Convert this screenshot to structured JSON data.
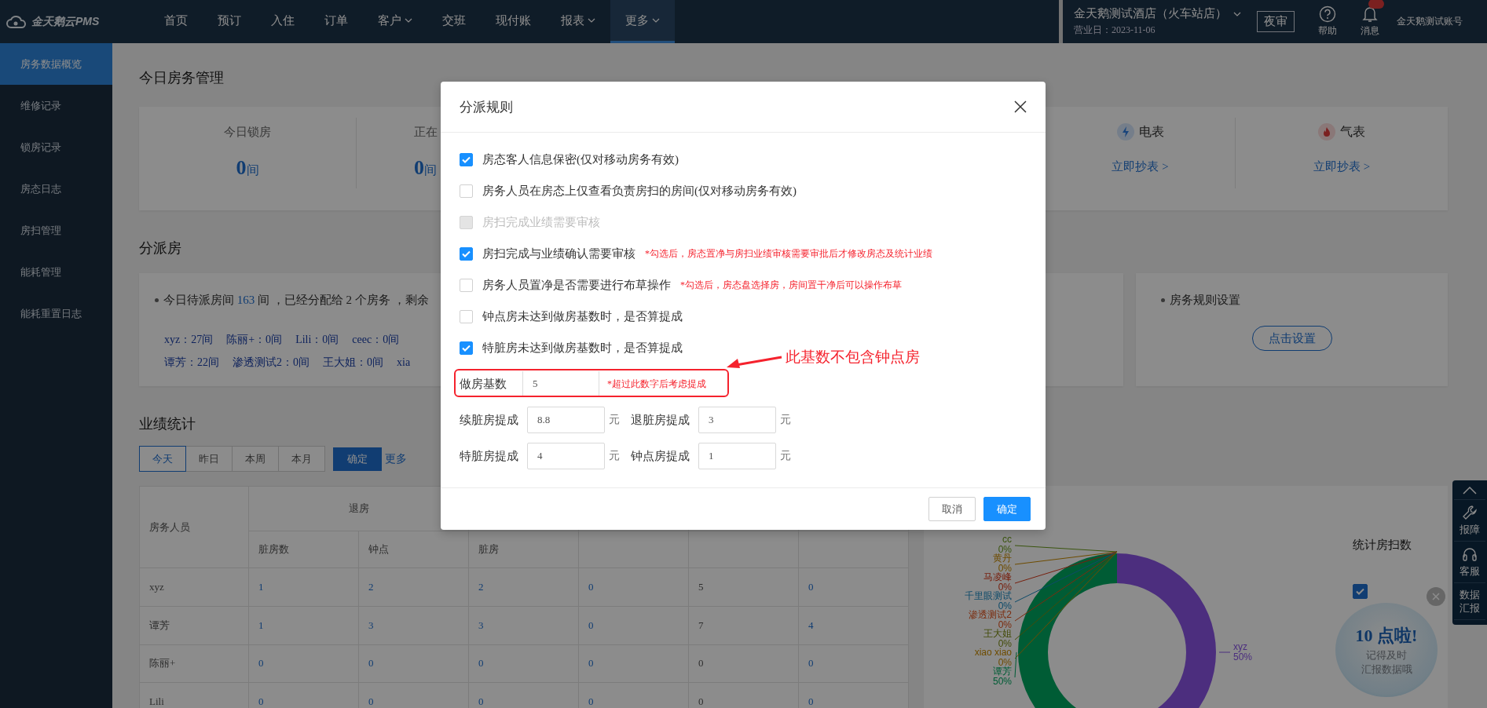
{
  "topbar": {
    "logo": "金天鹅云PMS",
    "nav": [
      {
        "label": "首页",
        "dropdown": false,
        "selected": false
      },
      {
        "label": "预订",
        "dropdown": false,
        "selected": false
      },
      {
        "label": "入住",
        "dropdown": false,
        "selected": false
      },
      {
        "label": "订单",
        "dropdown": false,
        "selected": false
      },
      {
        "label": "客户",
        "dropdown": true,
        "selected": false
      },
      {
        "label": "交班",
        "dropdown": false,
        "selected": false
      },
      {
        "label": "现付账",
        "dropdown": false,
        "selected": false
      },
      {
        "label": "报表",
        "dropdown": true,
        "selected": false
      },
      {
        "label": "更多",
        "dropdown": true,
        "selected": true
      }
    ],
    "hotel": "金天鹅测试酒店（火车站店）",
    "business_date": "营业日：2023-11-06",
    "night_audit": "夜审",
    "help": "帮助",
    "messages": "消息",
    "account": "金天鹅测试账号"
  },
  "sidebar": [
    {
      "label": "房务数据概览",
      "selected": true
    },
    {
      "label": "维修记录",
      "selected": false
    },
    {
      "label": "锁房记录",
      "selected": false
    },
    {
      "label": "房态日志",
      "selected": false
    },
    {
      "label": "房扫管理",
      "selected": false
    },
    {
      "label": "能耗管理",
      "selected": false
    },
    {
      "label": "能耗重置日志",
      "selected": false
    }
  ],
  "room_management": {
    "title": "今日房务管理",
    "stats": [
      {
        "label": "今日锁房",
        "value": "0",
        "unit": "间"
      },
      {
        "label": "正在",
        "value": "0",
        "unit": "间"
      }
    ],
    "meters": [
      {
        "kind": "electric",
        "label": "电表",
        "link": "立即抄表 >"
      },
      {
        "kind": "gas",
        "label": "气表",
        "link": "立即抄表 >"
      }
    ]
  },
  "dispatch": {
    "title": "分派房",
    "summary": [
      {
        "kind": "text",
        "text": "今日待派房间"
      },
      {
        "kind": "count",
        "text": "163"
      },
      {
        "kind": "text",
        "text": "间 ，已经分配给 2 个房务 ，剩余"
      }
    ],
    "staff": [
      [
        "xyz：27间",
        "陈丽+：0间",
        "Lili：0间",
        "ceec：0间"
      ],
      [
        "谭芳：22间",
        "渗透测试2：0间",
        "王大姐：0间",
        "xia"
      ]
    ],
    "rules": {
      "label": "房务规则设置",
      "button": "点击设置"
    }
  },
  "performance": {
    "title": "业绩统计",
    "periods": [
      {
        "label": "今天",
        "selected": true
      },
      {
        "label": "昨日",
        "selected": false
      },
      {
        "label": "本周",
        "selected": false
      },
      {
        "label": "本月",
        "selected": false
      }
    ],
    "confirm": "确定",
    "more": "更多",
    "table": {
      "name_header": "房务人员",
      "group": "退房",
      "columns": [
        {
          "label": "脏房数",
          "link": true
        },
        {
          "label": "钟点",
          "link": true
        },
        {
          "label": "脏房",
          "link": true
        },
        {
          "link": true
        },
        {
          "link": false
        },
        {
          "link": true
        }
      ],
      "rows": [
        {
          "name": "xyz",
          "cells": [
            "1",
            "2",
            "2",
            "0",
            "5",
            "0"
          ]
        },
        {
          "name": "谭芳",
          "cells": [
            "1",
            "3",
            "3",
            "0",
            "7",
            "4"
          ]
        },
        {
          "name": "陈丽+",
          "cells": [
            "0",
            "0",
            "0",
            "0",
            "0",
            "0"
          ]
        },
        {
          "name": "Lili",
          "cells": [
            "0",
            "0",
            "0",
            "0",
            "0",
            "0"
          ]
        }
      ]
    },
    "chart_title": "统计房扫数",
    "stat_options": [
      {
        "checked": true
      }
    ],
    "chart_data": {
      "type": "donut",
      "categories": [
        "xyz",
        "谭芳",
        "cc",
        "黄丹",
        "马凌峰",
        "千里眼测试",
        "渗透测试2",
        "王大姐",
        "xiao xiao"
      ],
      "values": [
        50,
        50,
        0,
        0,
        0,
        0,
        0,
        0,
        0
      ],
      "colors": [
        "#8a55e6",
        "#00a862",
        "#6a9a1a",
        "#c88a00",
        "#d83a1a",
        "#1a88c0",
        "#e0501a",
        "#7a8a10",
        "#c88a00"
      ],
      "value_labels": [
        "50%",
        "50%",
        "0%",
        "0%",
        "0%",
        "0%",
        "0%",
        "0%",
        "0%"
      ]
    }
  },
  "widgets": {
    "toolbar": [
      "报障",
      "客服",
      "数据汇报"
    ],
    "reminder": {
      "title": "10 点啦!",
      "lines": [
        "记得及时",
        "汇报数据哦"
      ]
    }
  },
  "modal": {
    "title": "分派规则",
    "options": [
      {
        "label": "房态客人信息保密(仅对移动房务有效)",
        "checked": true,
        "disabled": false
      },
      {
        "label": "房务人员在房态上仅查看负责房扫的房间(仅对移动房务有效)",
        "checked": false,
        "disabled": false
      },
      {
        "label": "房扫完成业绩需要审核",
        "checked": false,
        "disabled": true
      },
      {
        "label": "房扫完成与业绩确认需要审核",
        "checked": true,
        "disabled": false,
        "note": "*勾选后，房态置净与房扫业绩审核需要审批后才修改房态及统计业绩"
      },
      {
        "label": "房务人员置净是否需要进行布草操作",
        "checked": false,
        "disabled": false,
        "note": "*勾选后，房态盘选择房，房间置干净后可以操作布草"
      },
      {
        "label": "钟点房未达到做房基数时，是否算提成",
        "checked": false,
        "disabled": false
      },
      {
        "label": "特脏房未达到做房基数时，是否算提成",
        "checked": true,
        "disabled": false
      }
    ],
    "base": {
      "label": "做房基数",
      "value": "5",
      "note": "*超过此数字后考虑提成"
    },
    "annotation": "此基数不包含钟点房",
    "commissions": [
      {
        "label": "续脏房提成",
        "value": "8.8",
        "unit": "元"
      },
      {
        "label": "退脏房提成",
        "value": "3",
        "unit": "元"
      },
      {
        "label": "特脏房提成",
        "value": "4",
        "unit": "元"
      },
      {
        "label": "钟点房提成",
        "value": "1",
        "unit": "元"
      }
    ],
    "buttons": [
      {
        "kind": "secondary",
        "label": "取消"
      },
      {
        "kind": "primary",
        "label": "确定"
      }
    ]
  }
}
